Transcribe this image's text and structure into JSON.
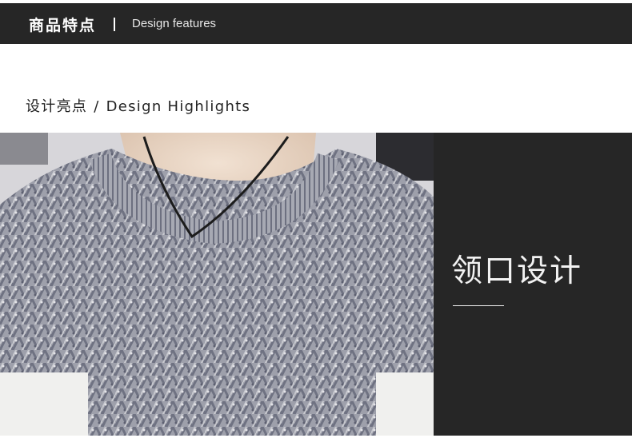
{
  "header": {
    "title_cn": "商品特点",
    "title_en": "Design features"
  },
  "highlight": {
    "cn": "设计亮点",
    "slash": "/",
    "en": "Design Highlights"
  },
  "feature": {
    "title": "领口设计"
  },
  "colors": {
    "bar_bg": "#262626",
    "panel_bg": "#262626",
    "text_light": "#f2f2f2"
  }
}
